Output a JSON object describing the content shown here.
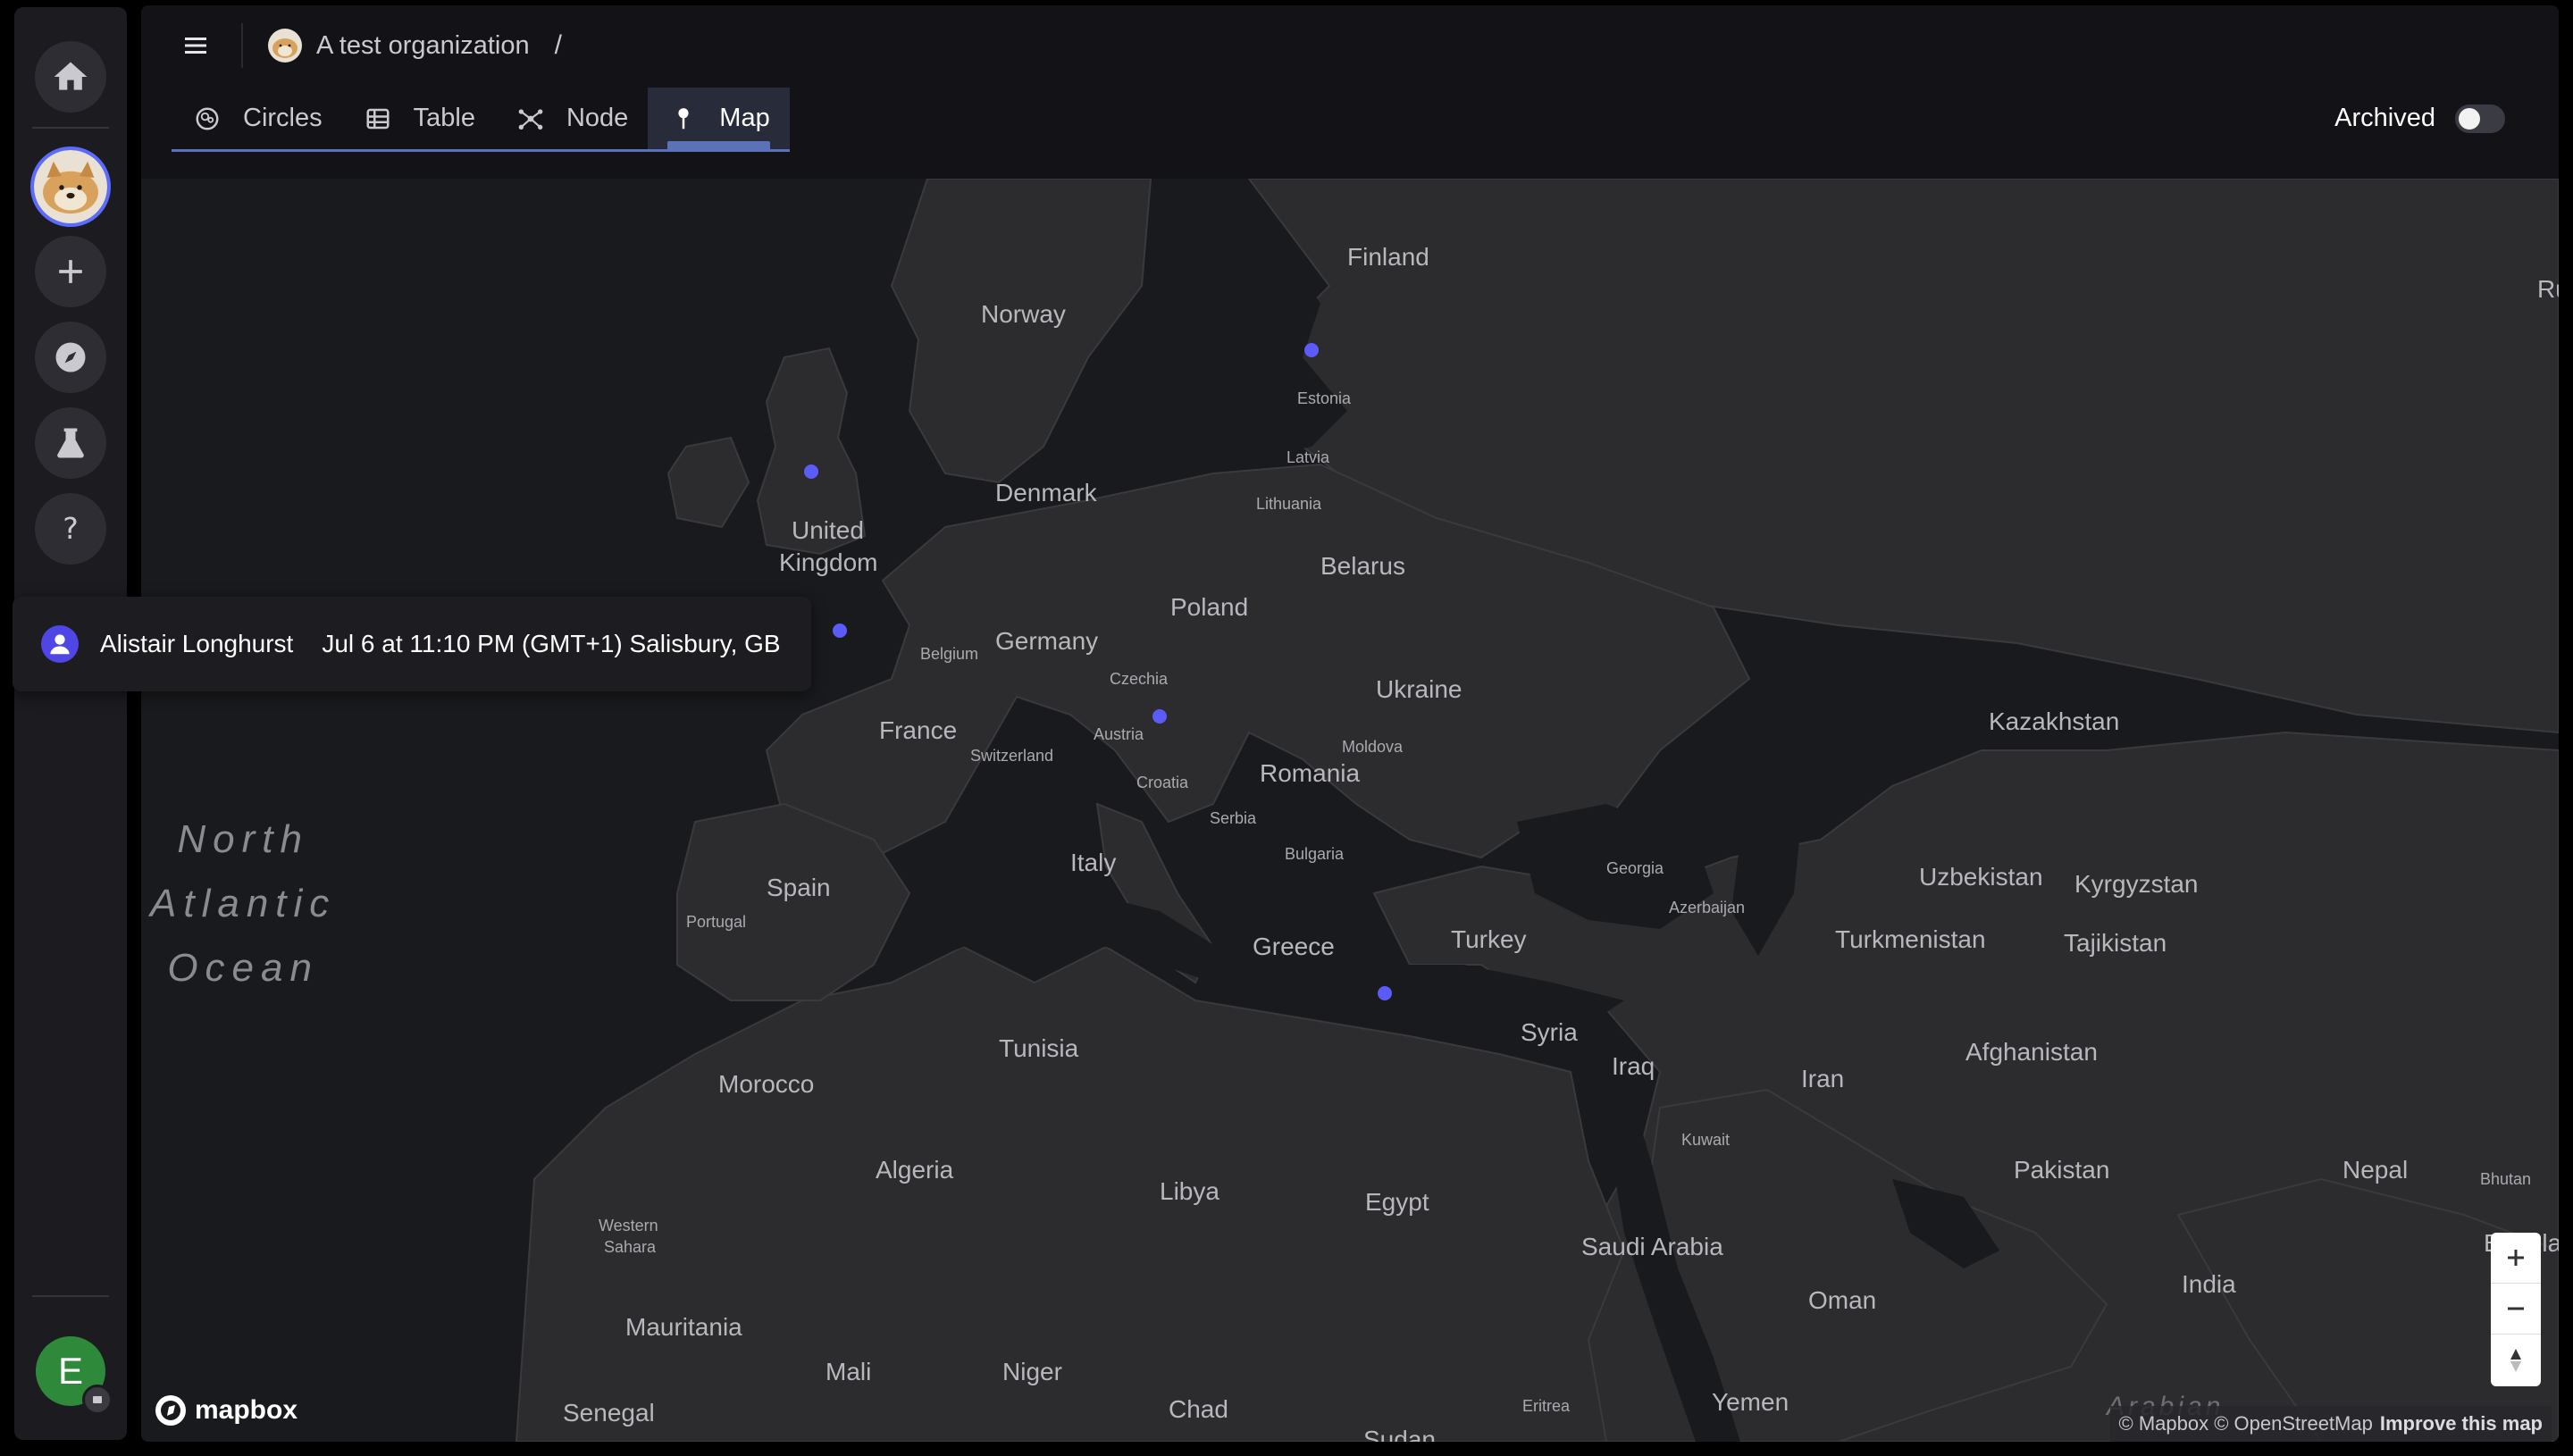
{
  "header": {
    "org_name": "A test organization",
    "crumb_separator": "/"
  },
  "tabs": [
    {
      "label": "Circles",
      "icon": "circles-icon"
    },
    {
      "label": "Table",
      "icon": "table-icon"
    },
    {
      "label": "Node",
      "icon": "node-graph-icon"
    },
    {
      "label": "Map",
      "icon": "map-pin-icon",
      "active": true
    }
  ],
  "archived": {
    "label": "Archived",
    "enabled": false
  },
  "sidebar": {
    "items": [
      "home-icon",
      "org-avatar",
      "plus-icon",
      "compass-icon",
      "flask-icon",
      "help-icon"
    ],
    "user_initial": "E"
  },
  "tooltip": {
    "name": "Alistair Longhurst",
    "info": "Jul 6 at 11:10 PM (GMT+1) Salisbury, GB"
  },
  "map": {
    "labels": {
      "finland": "Finland",
      "norway": "Norway",
      "estonia": "Estonia",
      "latvia": "Latvia",
      "lithuania": "Lithuania",
      "denmark": "Denmark",
      "uk1": "United",
      "uk2": "Kingdom",
      "belarus": "Belarus",
      "poland": "Poland",
      "germany": "Germany",
      "belgium": "Belgium",
      "czechia": "Czechia",
      "ukraine": "Ukraine",
      "kazakhstan": "Kazakhstan",
      "austria": "Austria",
      "france": "France",
      "switzerland": "Switzerland",
      "moldova": "Moldova",
      "croatia": "Croatia",
      "romania": "Romania",
      "serbia": "Serbia",
      "bulgaria": "Bulgaria",
      "italy": "Italy",
      "spain": "Spain",
      "portugal": "Portugal",
      "georgia": "Georgia",
      "azerbaijan": "Azerbaijan",
      "uzbekistan": "Uzbekistan",
      "kyrgyzstan": "Kyrgyzstan",
      "turkmenistan": "Turkmenistan",
      "tajikistan": "Tajikistan",
      "greece": "Greece",
      "turkey": "Turkey",
      "syria": "Syria",
      "tunisia": "Tunisia",
      "morocco": "Morocco",
      "iraq": "Iraq",
      "iran": "Iran",
      "afghanistan": "Afghanistan",
      "kuwait": "Kuwait",
      "algeria": "Algeria",
      "libya": "Libya",
      "egypt": "Egypt",
      "pakistan": "Pakistan",
      "nepal": "Nepal",
      "bhutan": "Bhutan",
      "saudi": "Saudi Arabia",
      "oman": "Oman",
      "india": "India",
      "bangladesh": "Banglade",
      "wsahara1": "Western",
      "wsahara2": "Sahara",
      "mauritania": "Mauritania",
      "mali": "Mali",
      "niger": "Niger",
      "chad": "Chad",
      "senegal": "Senegal",
      "eritrea": "Eritrea",
      "yemen": "Yemen",
      "sudan": "Sudan",
      "ru": "Ru",
      "ocean1": "North",
      "ocean2": "Atlantic",
      "ocean3": "Ocean",
      "arabian": "Arabian"
    },
    "attribution_text": "© Mapbox © OpenStreetMap",
    "attribution_link": "Improve this map",
    "logo_text": "mapbox",
    "marker_color": "#5b5bf8"
  }
}
